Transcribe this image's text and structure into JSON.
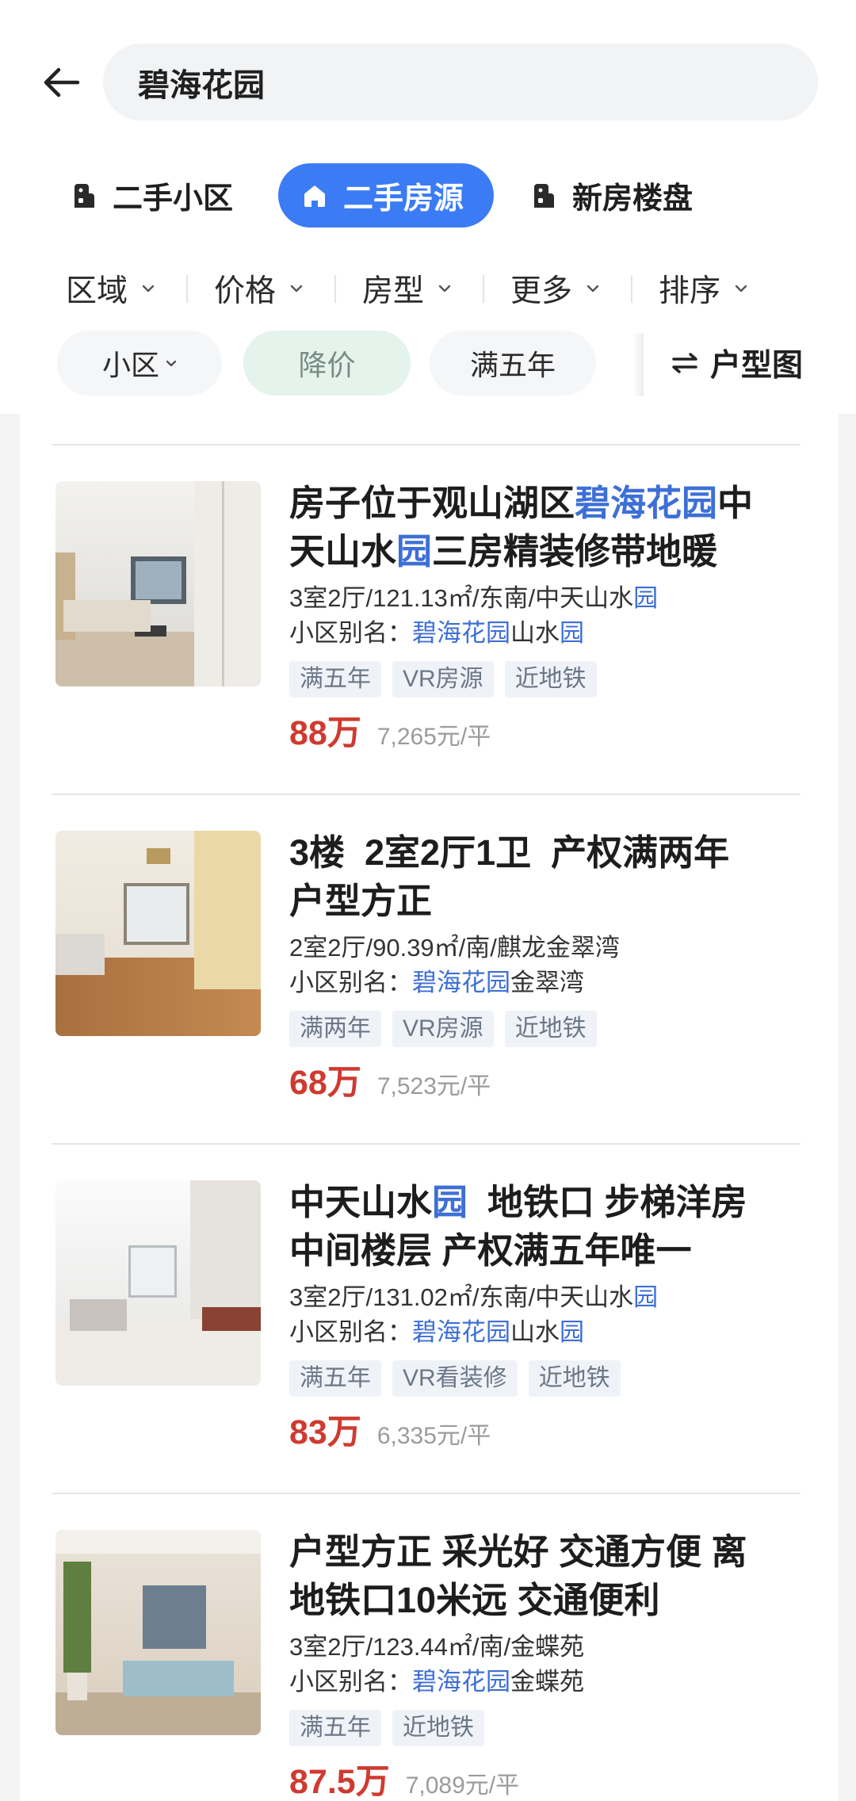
{
  "header": {
    "back_icon": "arrow-left-icon",
    "search_text": "碧海花园"
  },
  "tabs": [
    {
      "label": "二手小区",
      "icon": "building-icon",
      "active": false
    },
    {
      "label": "二手房源",
      "icon": "house-icon",
      "active": true
    },
    {
      "label": "新房楼盘",
      "icon": "building-icon",
      "active": false
    }
  ],
  "filters": [
    {
      "label": "区域",
      "icon": "chevron-down-icon"
    },
    {
      "label": "价格",
      "icon": "chevron-down-icon"
    },
    {
      "label": "房型",
      "icon": "chevron-down-icon"
    },
    {
      "label": "更多",
      "icon": "chevron-down-icon"
    },
    {
      "label": "排序",
      "icon": "chevron-down-icon"
    }
  ],
  "chips": [
    {
      "label": "小区",
      "dropdown": true,
      "selected": false
    },
    {
      "label": "降价",
      "dropdown": false,
      "selected": true
    },
    {
      "label": "满五年",
      "dropdown": false,
      "selected": false
    }
  ],
  "floorplan": {
    "label": "户型图",
    "icon": "swap-arrows-icon"
  },
  "colors": {
    "accent": "#3b7cf5",
    "highlight": "#3d6fd6",
    "price": "#cf3a30",
    "selected_chip_bg": "#e4f3ec",
    "tag_bg": "#eff3f8"
  },
  "listings": [
    {
      "title_lines": [
        [
          {
            "text": "房子位于观山湖区"
          },
          {
            "text": "碧海花园",
            "hl": true
          },
          {
            "text": "中"
          }
        ],
        [
          {
            "text": "天山水"
          },
          {
            "text": "园",
            "hl": true
          },
          {
            "text": "三房精装修带地暖"
          }
        ]
      ],
      "info": [
        {
          "text": "3室2厅/121.13㎡/东南/中天山水"
        },
        {
          "text": "园",
          "hl": true
        }
      ],
      "alias": [
        {
          "text": "小区别名："
        },
        {
          "text": "碧海花园",
          "hl": true
        },
        {
          "text": "山水"
        },
        {
          "text": "园",
          "hl": true
        }
      ],
      "tags": [
        "满五年",
        "VR房源",
        "近地铁"
      ],
      "price": "88万",
      "unit_price": "7,265元/平"
    },
    {
      "title_lines": [
        [
          {
            "text": "3楼  2室2厅1卫  产权满两年"
          }
        ],
        [
          {
            "text": "户型方正"
          }
        ]
      ],
      "info": [
        {
          "text": "2室2厅/90.39㎡/南/麒龙金翠湾"
        }
      ],
      "alias": [
        {
          "text": "小区别名："
        },
        {
          "text": "碧海花园",
          "hl": true
        },
        {
          "text": "金翠湾"
        }
      ],
      "tags": [
        "满两年",
        "VR房源",
        "近地铁"
      ],
      "price": "68万",
      "unit_price": "7,523元/平"
    },
    {
      "title_lines": [
        [
          {
            "text": "中天山水"
          },
          {
            "text": "园",
            "hl": true
          },
          {
            "text": "  地铁口 步梯洋房"
          }
        ],
        [
          {
            "text": "中间楼层 产权满五年唯一"
          }
        ]
      ],
      "info": [
        {
          "text": "3室2厅/131.02㎡/东南/中天山水"
        },
        {
          "text": "园",
          "hl": true
        }
      ],
      "alias": [
        {
          "text": "小区别名："
        },
        {
          "text": "碧海花园",
          "hl": true
        },
        {
          "text": "山水"
        },
        {
          "text": "园",
          "hl": true
        }
      ],
      "tags": [
        "满五年",
        "VR看装修",
        "近地铁"
      ],
      "price": "83万",
      "unit_price": "6,335元/平"
    },
    {
      "title_lines": [
        [
          {
            "text": "户型方正 采光好 交通方便 离"
          }
        ],
        [
          {
            "text": "地铁口10米远 交通便利"
          }
        ]
      ],
      "info": [
        {
          "text": "3室2厅/123.44㎡/南/金蝶苑"
        }
      ],
      "alias": [
        {
          "text": "小区别名："
        },
        {
          "text": "碧海花园",
          "hl": true
        },
        {
          "text": "金蝶苑"
        }
      ],
      "tags": [
        "满五年",
        "近地铁"
      ],
      "price": "87.5万",
      "unit_price": "7,089元/平"
    }
  ]
}
